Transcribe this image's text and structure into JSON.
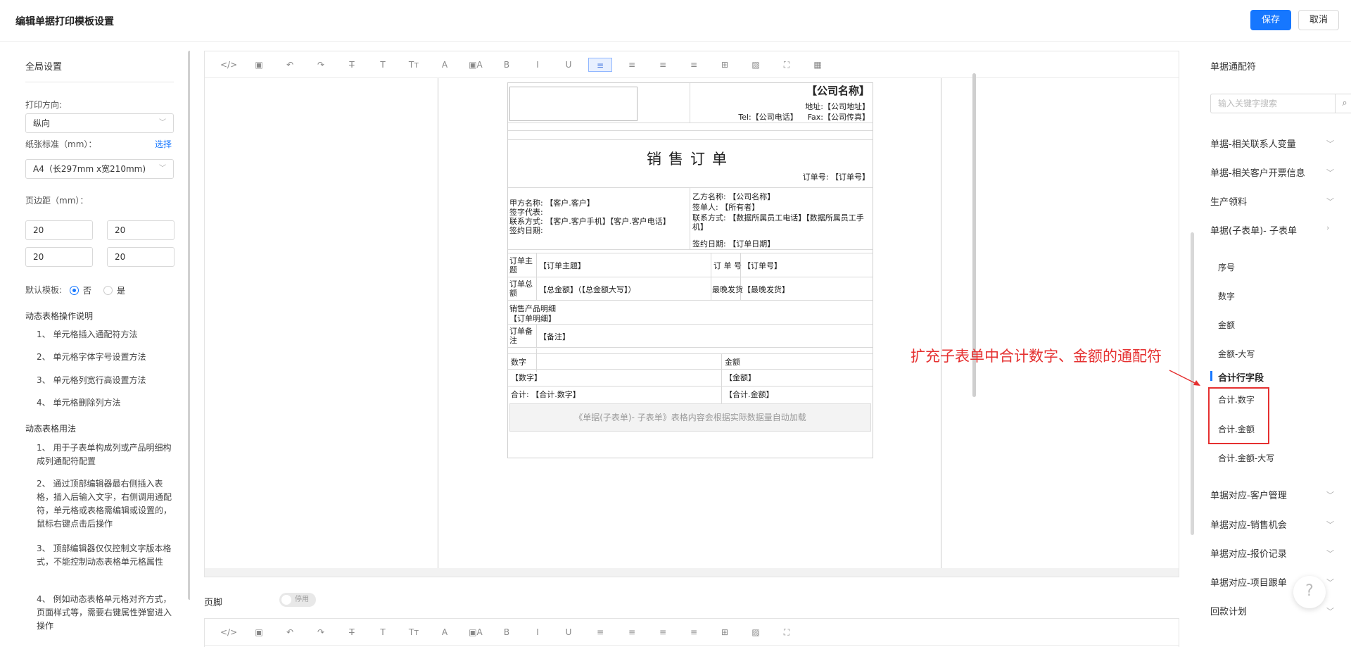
{
  "header": {
    "title": "编辑单据打印模板设置",
    "save_label": "保存",
    "cancel_label": "取消"
  },
  "left": {
    "section_title": "全局设置",
    "orientation_label": "打印方向:",
    "orientation_value": "纵向",
    "paper_label": "纸张标准（mm）：",
    "paper_link": "选择",
    "paper_value": "A4（长297mm x宽210mm)",
    "margin_label": "页边距（mm）：",
    "margins": [
      "20",
      "20",
      "20",
      "20"
    ],
    "default_label": "默认模板:",
    "default_no": "否",
    "default_yes": "是",
    "ops_title": "动态表格操作说明",
    "ops": [
      "1、 单元格插入通配符方法",
      "2、 单元格字体字号设置方法",
      "3、 单元格列宽行高设置方法",
      "4、 单元格删除列方法"
    ],
    "usage_title": "动态表格用法",
    "usage": [
      "1、 用于子表单构成列或产品明细构成列通配符配置",
      "2、 通过顶部编辑器最右侧插入表格，插入后输入文字，右侧调用通配符，单元格或表格需编辑或设置的，鼠标右键点击后操作",
      "3、 顶部编辑器仅仅控制文字版本格式，不能控制动态表格单元格属性",
      "4、 例如动态表格单元格对齐方式，页面样式等，需要右键属性弹窗进入操作"
    ]
  },
  "toolbar_icons": [
    "source-icon",
    "template-icon",
    "undo-icon",
    "redo-icon",
    "strikethrough-icon",
    "text-icon",
    "font-size-icon",
    "font-color-icon",
    "bg-color-icon",
    "bold-icon",
    "italic-icon",
    "underline-icon",
    "align-left-icon",
    "align-center-icon",
    "align-right-icon",
    "justify-icon",
    "table-icon",
    "image-icon",
    "fullscreen-icon",
    "dynamic-table-icon"
  ],
  "toolbar_glyphs": [
    "</>",
    "▣",
    "↶",
    "↷",
    "T̶",
    "T",
    "Tт",
    "A",
    "▣A",
    "B",
    "I",
    "U",
    "≡",
    "≡",
    "≡",
    "≡",
    "⊞",
    "▨",
    "⛶",
    "▦"
  ],
  "doc": {
    "company_name": "【公司名称】",
    "address": "地址:【公司地址】",
    "tel_fax": "Tel:【公司电话】    Fax:【公司传真】",
    "title": "销售订单",
    "order_no": "订单号: 【订单号】",
    "party_a": [
      "甲方名称: 【客户.客户】",
      "签字代表:",
      "联系方式: 【客户.客户手机】【客户.客户电话】",
      "签约日期:"
    ],
    "party_b": [
      "乙方名称: 【公司名称】",
      "签单人: 【所有者】",
      "联系方式: 【数据所属员工电话】【数据所属员工手机】",
      "签约日期: 【订单日期】"
    ],
    "row1_label": "订单主题",
    "row1_value": "【订单主题】",
    "row1_label2": "订 单 号",
    "row1_value2": "【订单号】",
    "row2_label": "订单总额",
    "row2_value": "【总金额】（【总金额大写】）",
    "row2_label2": "最晚发货",
    "row2_value2": "【最晚发货】",
    "detail_label": "销售产品明细",
    "detail_value": "【订单明细】",
    "remark_label": "订单备注",
    "remark_value": "【备注】",
    "sub_head": [
      "数字",
      "金额"
    ],
    "sub_row": [
      "【数字】",
      "【金额】"
    ],
    "sub_total": [
      "合计: 【合计.数字】",
      "【合计.金额】"
    ],
    "loading_text": "《单据(子表单)- 子表单》表格内容会根据实际数据量自动加载"
  },
  "footer": {
    "label": "页脚",
    "toggle": "停用"
  },
  "right": {
    "section_title": "单据通配符",
    "search_placeholder": "输入关键字搜索",
    "groups_top": [
      "单据-相关联系人变量",
      "单据-相关客户开票信息",
      "生产领料",
      "单据(子表单)- 子表单"
    ],
    "sub_items": [
      "序号",
      "数字",
      "金额",
      "金额-大写"
    ],
    "subtotal_header": "合计行字段",
    "subtotal_items": [
      "合计.数字",
      "合计.金额",
      "合计.金额-大写"
    ],
    "groups_bottom": [
      "单据对应-客户管理",
      "单据对应-销售机会",
      "单据对应-报价记录",
      "单据对应-项目跟单",
      "回款计划"
    ]
  },
  "annotation": "扩充子表单中合计数字、金额的通配符",
  "colors": {
    "primary": "#1677ff",
    "annotation": "#e53030"
  }
}
